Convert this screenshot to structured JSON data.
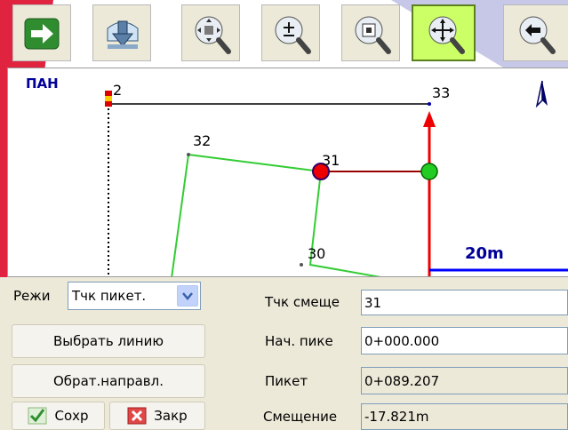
{
  "toolbar": {
    "buttons": [
      {
        "name": "next-arrow-icon",
        "active": false
      },
      {
        "name": "download-icon",
        "active": false
      },
      {
        "name": "zoom-extents-icon",
        "active": false
      },
      {
        "name": "zoom-in-out-icon",
        "active": false
      },
      {
        "name": "zoom-window-icon",
        "active": false
      },
      {
        "name": "zoom-pan-icon",
        "active": true
      },
      {
        "name": "zoom-previous-icon",
        "active": false
      }
    ]
  },
  "map": {
    "mode_label": "ПАН",
    "points": [
      "2",
      "33",
      "32",
      "31",
      "30"
    ],
    "scale_label": "20m",
    "colors": {
      "polyline": "#33cc33",
      "reference": "#000000",
      "offset_line": "#990000",
      "station_line": "#ee0000",
      "scale_bar": "#0000ff",
      "mode_text": "#000099"
    }
  },
  "form": {
    "mode_label": "Режи",
    "mode_value": "Тчк пикет.",
    "select_line_button": "Выбрать линию",
    "reverse_button": "Обрат.направл.",
    "save_button": "Сохр",
    "close_button": "Закр",
    "offset_point_label": "Тчк смеще",
    "offset_point_value": "31",
    "start_station_label": "Нач. пике",
    "start_station_value": "0+000.000",
    "station_label": "Пикет",
    "station_value": "0+089.207",
    "offset_label": "Смещение",
    "offset_value": "-17.821m"
  }
}
